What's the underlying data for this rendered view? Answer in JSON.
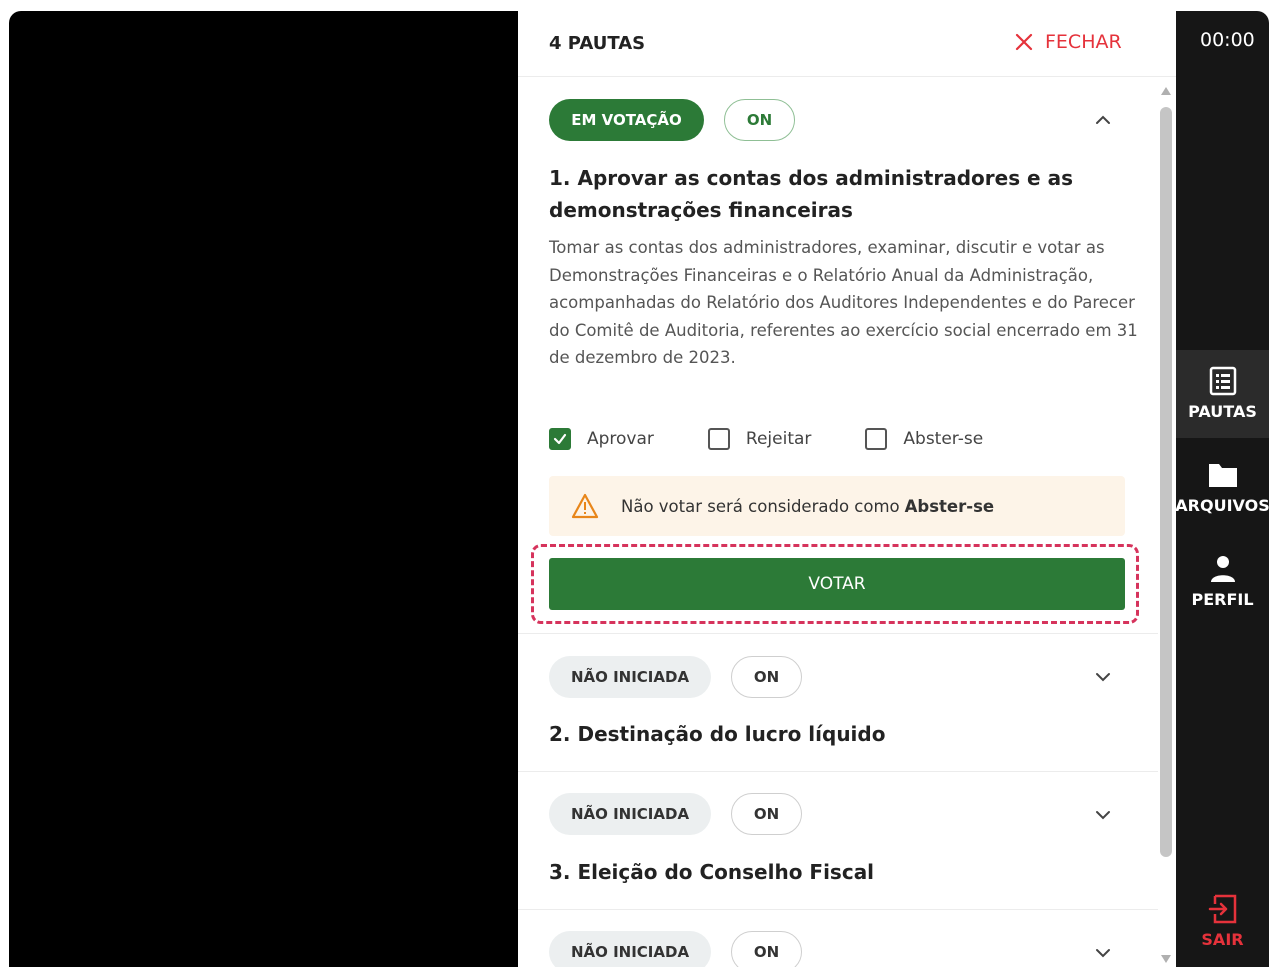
{
  "panel": {
    "title": "4 PAUTAS",
    "close_label": "FECHAR"
  },
  "items": [
    {
      "status": "EM VOTAÇÃO",
      "mode": "ON",
      "title_line1": "1. Aprovar as contas dos administradores e as",
      "title_line2": "demonstrações financeiras",
      "description": "Tomar as contas dos administradores, examinar, discutir e votar as Demonstrações Financeiras e o Relatório Anual da Administração, acompanhadas do Relatório dos Auditores Independentes e do Parecer do Comitê de Auditoria, referentes ao exercício social encerrado em 31 de dezembro de 2023.",
      "expanded": true,
      "options": [
        {
          "label": "Aprovar",
          "checked": true
        },
        {
          "label": "Rejeitar",
          "checked": false
        },
        {
          "label": "Abster-se",
          "checked": false
        }
      ],
      "warning_text": "Não votar será considerado como",
      "warning_bold": "Abster-se",
      "vote_label": "VOTAR"
    },
    {
      "status": "NÃO INICIADA",
      "mode": "ON",
      "title": "2. Destinação do lucro líquido",
      "expanded": false
    },
    {
      "status": "NÃO INICIADA",
      "mode": "ON",
      "title": "3. Eleição do Conselho Fiscal",
      "expanded": false
    },
    {
      "status": "NÃO INICIADA",
      "mode": "ON",
      "expanded": false
    }
  ],
  "sidebar": {
    "timer": "00:00",
    "items": [
      {
        "label": "PAUTAS",
        "icon": "list-icon",
        "active": true
      },
      {
        "label": "ARQUIVOS",
        "icon": "folder-icon",
        "active": false
      },
      {
        "label": "PERFIL",
        "icon": "user-icon",
        "active": false
      }
    ],
    "exit_label": "SAIR"
  },
  "colors": {
    "primary_green": "#2c7a37",
    "danger_red": "#e5323b",
    "warning_bg": "#fdf4e8",
    "highlight": "#d6335c"
  }
}
